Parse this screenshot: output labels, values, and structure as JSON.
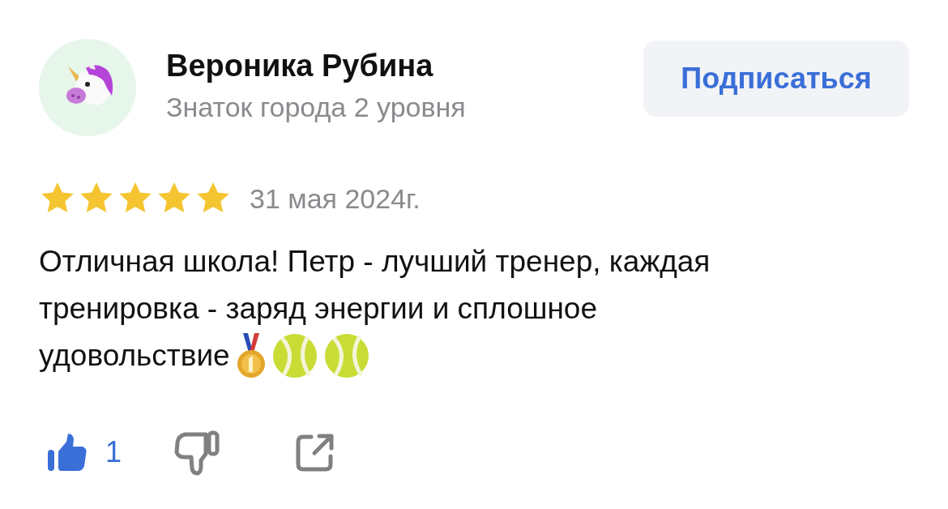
{
  "author": {
    "name": "Вероника Рубина",
    "subtitle": "Знаток города 2 уровня"
  },
  "subscribe_button": {
    "label": "Подписаться"
  },
  "rating": {
    "stars": 5,
    "date": "31 мая 2024г."
  },
  "review": {
    "text_lines": [
      "Отличная школа! Петр - лучший тренер, каждая",
      "тренировка - заряд энергии и сплошное",
      "удовольствие"
    ],
    "emojis": [
      {
        "kind": "medal"
      },
      {
        "kind": "tennis_ball"
      },
      {
        "kind": "tennis_ball"
      }
    ]
  },
  "actions": {
    "like": {
      "count": "1",
      "selected": true
    },
    "dislike": {
      "selected": false
    }
  }
}
